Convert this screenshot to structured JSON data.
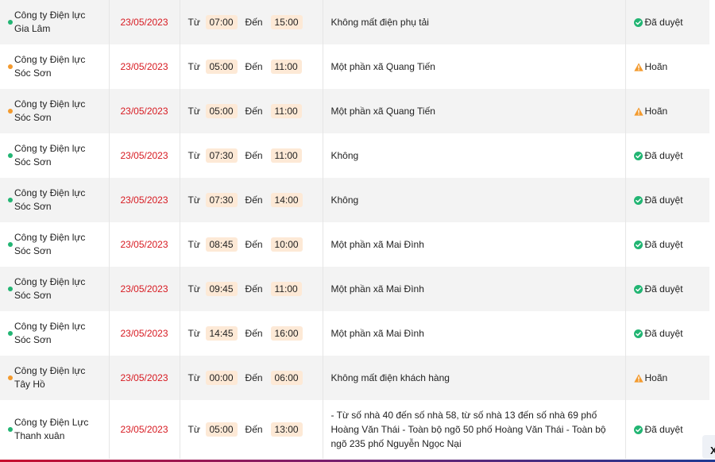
{
  "labels": {
    "from": "Từ",
    "to": "Đến"
  },
  "colors": {
    "approved": "#22b573",
    "postponed": "#f39a2e",
    "date": "#d71920"
  },
  "rows": [
    {
      "unit": "Công ty Điện lực Gia Lâm",
      "date": "23/05/2023",
      "start": "07:00",
      "end": "15:00",
      "area": "Không mất điện phụ tải",
      "status": "Đã duyệt",
      "state": "approved"
    },
    {
      "unit": "Công ty Điện lực Sóc Sơn",
      "date": "23/05/2023",
      "start": "05:00",
      "end": "11:00",
      "area": "Một phần xã Quang Tiến",
      "status": "Hoãn",
      "state": "postponed"
    },
    {
      "unit": "Công ty Điện lực Sóc Sơn",
      "date": "23/05/2023",
      "start": "05:00",
      "end": "11:00",
      "area": "Một phần xã Quang Tiến",
      "status": "Hoãn",
      "state": "postponed"
    },
    {
      "unit": "Công ty Điện lực Sóc Sơn",
      "date": "23/05/2023",
      "start": "07:30",
      "end": "11:00",
      "area": "Không",
      "status": "Đã duyệt",
      "state": "approved"
    },
    {
      "unit": "Công ty Điện lực Sóc Sơn",
      "date": "23/05/2023",
      "start": "07:30",
      "end": "14:00",
      "area": "Không",
      "status": "Đã duyệt",
      "state": "approved"
    },
    {
      "unit": "Công ty Điện lực Sóc Sơn",
      "date": "23/05/2023",
      "start": "08:45",
      "end": "10:00",
      "area": "Một phần xã Mai Đình",
      "status": "Đã duyệt",
      "state": "approved"
    },
    {
      "unit": "Công ty Điện lực Sóc Sơn",
      "date": "23/05/2023",
      "start": "09:45",
      "end": "11:00",
      "area": "Một phần xã Mai Đình",
      "status": "Đã duyệt",
      "state": "approved"
    },
    {
      "unit": "Công ty Điện lực Sóc Sơn",
      "date": "23/05/2023",
      "start": "14:45",
      "end": "16:00",
      "area": "Một phần xã Mai Đình",
      "status": "Đã duyệt",
      "state": "approved"
    },
    {
      "unit": "Công ty Điện lực Tây Hồ",
      "date": "23/05/2023",
      "start": "00:00",
      "end": "06:00",
      "area": "Không mất điện khách hàng",
      "status": "Hoãn",
      "state": "postponed"
    },
    {
      "unit": "Công ty Điện Lực Thanh xuân",
      "date": "23/05/2023",
      "start": "05:00",
      "end": "13:00",
      "area": "- Từ số nhà 40 đến số nhà 58, từ số nhà 13 đến số nhà 69 phố Hoàng Văn Thái - Toàn bộ ngõ 50 phố Hoàng Văn Thái - Toàn bộ ngõ 235 phố Nguyễn Ngọc Nại",
      "status": "Đã duyệt",
      "state": "approved"
    }
  ],
  "side_button": {
    "icon": "close-icon",
    "glyph": "X"
  }
}
